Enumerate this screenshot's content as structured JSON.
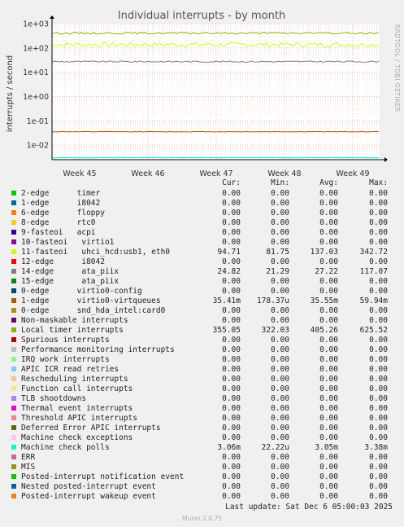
{
  "chart_data": {
    "type": "line",
    "title": "Individual interrupts - by month",
    "ylabel": "interrupts / second",
    "y_scale": "log",
    "y_ticks": [
      "1e+03",
      "1e+02",
      "1e+01",
      "1e+00",
      "1e-01",
      "1e-02"
    ],
    "x_ticks": [
      "Week 45",
      "Week 46",
      "Week 47",
      "Week 48",
      "Week 49"
    ],
    "grid": true,
    "side_label": "RRDTOOL / TOBI OETIKER",
    "columns": [
      "Cur:",
      "Min:",
      "Avg:",
      "Max:"
    ],
    "series": [
      {
        "name": "2-edge      timer",
        "color": "#00cc00",
        "values": [
          "0.00",
          "0.00",
          "0.00",
          "0.00"
        ]
      },
      {
        "name": "1-edge      i8042",
        "color": "#0066b3",
        "values": [
          "0.00",
          "0.00",
          "0.00",
          "0.00"
        ]
      },
      {
        "name": "6-edge      floppy",
        "color": "#ff8000",
        "values": [
          "0.00",
          "0.00",
          "0.00",
          "0.00"
        ]
      },
      {
        "name": "8-edge      rtc0",
        "color": "#ffcc00",
        "values": [
          "0.00",
          "0.00",
          "0.00",
          "0.00"
        ]
      },
      {
        "name": "9-fasteoi   acpi",
        "color": "#330099",
        "values": [
          "0.00",
          "0.00",
          "0.00",
          "0.00"
        ]
      },
      {
        "name": "10-fasteoi   virtio1",
        "color": "#990099",
        "values": [
          "0.00",
          "0.00",
          "0.00",
          "0.00"
        ]
      },
      {
        "name": "11-fasteoi   uhci_hcd:usb1, eth0",
        "color": "#ccff00",
        "values": [
          "94.71",
          "81.75",
          "137.03",
          "342.72"
        ]
      },
      {
        "name": "12-edge      i8042",
        "color": "#ff0000",
        "values": [
          "0.00",
          "0.00",
          "0.00",
          "0.00"
        ]
      },
      {
        "name": "14-edge      ata_piix",
        "color": "#808080",
        "values": [
          "24.82",
          "21.29",
          "27.22",
          "117.07"
        ]
      },
      {
        "name": "15-edge      ata_piix",
        "color": "#008f00",
        "values": [
          "0.00",
          "0.00",
          "0.00",
          "0.00"
        ]
      },
      {
        "name": "0-edge      virtio0-config",
        "color": "#00487d",
        "values": [
          "0.00",
          "0.00",
          "0.00",
          "0.00"
        ]
      },
      {
        "name": "1-edge      virtio0-virtqueues",
        "color": "#b35a00",
        "values": [
          "35.41m",
          "178.37u",
          "35.55m",
          "59.94m"
        ]
      },
      {
        "name": "0-edge      snd_hda_intel:card0",
        "color": "#b38f00",
        "values": [
          "0.00",
          "0.00",
          "0.00",
          "0.00"
        ]
      },
      {
        "name": "Non-maskable interrupts",
        "color": "#6b006b",
        "values": [
          "0.00",
          "0.00",
          "0.00",
          "0.00"
        ]
      },
      {
        "name": "Local timer interrupts",
        "color": "#8fb300",
        "values": [
          "355.05",
          "322.03",
          "405.26",
          "625.52"
        ]
      },
      {
        "name": "Spurious interrupts",
        "color": "#b30000",
        "values": [
          "0.00",
          "0.00",
          "0.00",
          "0.00"
        ]
      },
      {
        "name": "Performance monitoring interrupts",
        "color": "#bebebe",
        "values": [
          "0.00",
          "0.00",
          "0.00",
          "0.00"
        ]
      },
      {
        "name": "IRQ work interrupts",
        "color": "#80ff80",
        "values": [
          "0.00",
          "0.00",
          "0.00",
          "0.00"
        ]
      },
      {
        "name": "APIC ICR read retries",
        "color": "#80c9ff",
        "values": [
          "0.00",
          "0.00",
          "0.00",
          "0.00"
        ]
      },
      {
        "name": "Rescheduling interrupts",
        "color": "#ffc080",
        "values": [
          "0.00",
          "0.00",
          "0.00",
          "0.00"
        ]
      },
      {
        "name": "Function call interrupts",
        "color": "#ffe680",
        "values": [
          "0.00",
          "0.00",
          "0.00",
          "0.00"
        ]
      },
      {
        "name": "TLB shootdowns",
        "color": "#aa80ff",
        "values": [
          "0.00",
          "0.00",
          "0.00",
          "0.00"
        ]
      },
      {
        "name": "Thermal event interrupts",
        "color": "#ee00cc",
        "values": [
          "0.00",
          "0.00",
          "0.00",
          "0.00"
        ]
      },
      {
        "name": "Threshold APIC interrupts",
        "color": "#ff8080",
        "values": [
          "0.00",
          "0.00",
          "0.00",
          "0.00"
        ]
      },
      {
        "name": "Deferred Error APIC interrupts",
        "color": "#666600",
        "values": [
          "0.00",
          "0.00",
          "0.00",
          "0.00"
        ]
      },
      {
        "name": "Machine check exceptions",
        "color": "#ffbfff",
        "values": [
          "0.00",
          "0.00",
          "0.00",
          "0.00"
        ]
      },
      {
        "name": "Machine check polls",
        "color": "#00ffcc",
        "values": [
          "3.06m",
          "22.22u",
          "3.05m",
          "3.38m"
        ]
      },
      {
        "name": "ERR",
        "color": "#cc6699",
        "values": [
          "0.00",
          "0.00",
          "0.00",
          "0.00"
        ]
      },
      {
        "name": "MIS",
        "color": "#999900",
        "values": [
          "0.00",
          "0.00",
          "0.00",
          "0.00"
        ]
      },
      {
        "name": "Posted-interrupt notification event",
        "color": "#00cc00",
        "values": [
          "0.00",
          "0.00",
          "0.00",
          "0.00"
        ]
      },
      {
        "name": "Nested posted-interrupt event",
        "color": "#0066b3",
        "values": [
          "0.00",
          "0.00",
          "0.00",
          "0.00"
        ]
      },
      {
        "name": "Posted-interrupt wakeup event",
        "color": "#ff8000",
        "values": [
          "0.00",
          "0.00",
          "0.00",
          "0.00"
        ]
      }
    ],
    "last_update": "Last update: Sat Dec  6 05:00:03 2025",
    "footer": "Munin 2.0.75"
  }
}
